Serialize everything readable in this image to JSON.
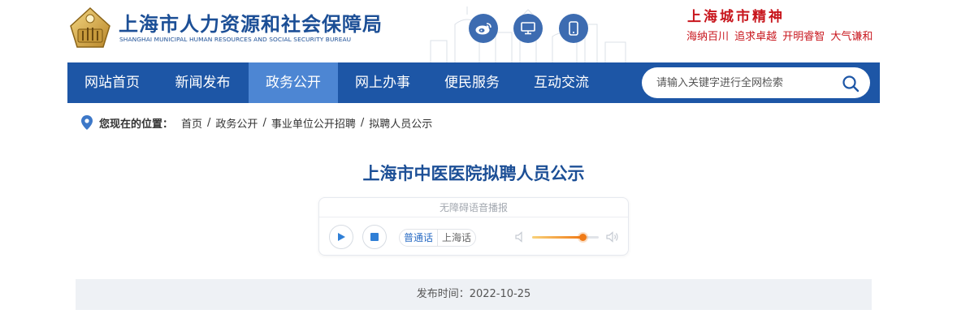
{
  "site": {
    "title_cn": "上海市人力资源和社会保障局",
    "title_en": "SHANGHAI MUNICIPAL HUMAN RESOURCES AND SOCIAL SECURITY BUREAU"
  },
  "header_icons": [
    "weibo-icon",
    "desktop-icon",
    "mobile-icon"
  ],
  "city_spirit": {
    "title": "上海城市精神",
    "slogan": "海纳百川 追求卓越 开明睿智 大气谦和"
  },
  "nav": {
    "items": [
      {
        "label": "网站首页"
      },
      {
        "label": "新闻发布"
      },
      {
        "label": "政务公开"
      },
      {
        "label": "网上办事"
      },
      {
        "label": "便民服务"
      },
      {
        "label": "互动交流"
      }
    ],
    "active_index": 2,
    "search_placeholder": "请输入关键字进行全网检索"
  },
  "breadcrumb": {
    "label": "您现在的位置：",
    "items": [
      "首页",
      "政务公开",
      "事业单位公开招聘",
      "拟聘人员公示"
    ],
    "separator": "/"
  },
  "article": {
    "title": "上海市中医医院拟聘人员公示",
    "publish_label": "发布时间：",
    "publish_date": "2022-10-25",
    "publish_text": "发布时间：2022-10-25"
  },
  "player": {
    "header": "无障碍语音播报",
    "languages": [
      "普通话",
      "上海话"
    ],
    "selected_language": "普通话",
    "volume_fraction": 0.76
  },
  "colors": {
    "brand_blue": "#1d56a6",
    "nav_active": "#4d86d3",
    "title_blue": "#1c4f96",
    "spirit_red": "#c8161d",
    "volume_orange": "#f07a16"
  }
}
